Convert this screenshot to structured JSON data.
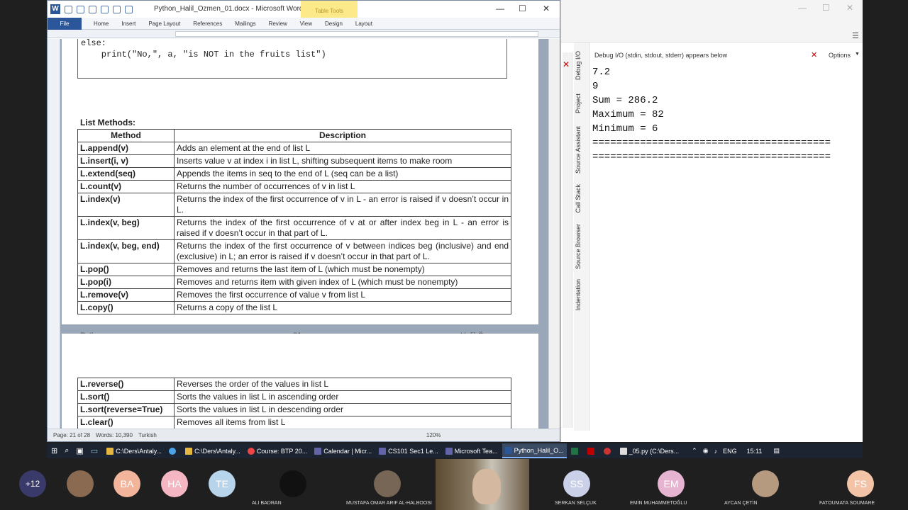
{
  "word": {
    "title": "Python_Halil_Ozmen_01.docx - Microsoft Word",
    "table_tools": "Table Tools",
    "tabs": [
      "File",
      "Home",
      "Insert",
      "Page Layout",
      "References",
      "Mailings",
      "Review",
      "View",
      "Design",
      "Layout"
    ],
    "code_lines": "else:\n    print(\"No,\", a, \"is NOT in the fruits list\")",
    "list_methods_title": "List Methods:",
    "table_headers": {
      "method": "Method",
      "description": "Description"
    },
    "rows": [
      {
        "m": "L.append(v)",
        "d": "Adds an element at the end of list L"
      },
      {
        "m": "L.insert(i, v)",
        "d": "Inserts value v at index i in list L, shifting subsequent items to make room"
      },
      {
        "m": "L.extend(seq)",
        "d": "Appends the items in seq to the end of L (seq can be a list)"
      },
      {
        "m": "L.count(v)",
        "d": "Returns the number of occurrences of v in list L"
      },
      {
        "m": "L.index(v)",
        "d": "Returns the index of the first occurrence of v in L - an error is raised if v doesn’t occur in L."
      },
      {
        "m": "L.index(v, beg)",
        "d": "Returns the index of the first occurrence of v at or after index beg in L - an error is raised if v doesn’t occur in that part of L."
      },
      {
        "m": "L.index(v, beg, end)",
        "d": "Returns the index of the first occurrence of v between indices beg (inclusive) and end (exclusive) in L; an error is raised if v doesn’t occur in that part of L."
      },
      {
        "m": "L.pop()",
        "d": "Removes and returns the last item of L (which must be nonempty)"
      },
      {
        "m": "L.pop(i)",
        "d": "Removes and returns item with given index of L (which must be nonempty)"
      },
      {
        "m": "L.remove(v)",
        "d": "Removes the first occurrence of value v from list L"
      },
      {
        "m": "L.copy()",
        "d": "Returns a copy of the list L"
      }
    ],
    "footer": {
      "left": "Python",
      "center": "21",
      "right": "Halil Özmen"
    },
    "rows2": [
      {
        "m": "L.reverse()",
        "d": "Reverses the order of the values in list L"
      },
      {
        "m": "L.sort()",
        "d": "Sorts the values in list L in ascending order"
      },
      {
        "m": "L.sort(reverse=True)",
        "d": "Sorts the values in list L in descending order"
      },
      {
        "m": "L.clear()",
        "d": "Removes all items from list L"
      }
    ],
    "status": {
      "page": "Page: 21 of 28",
      "words": "Words: 10,390",
      "lang": "Turkish",
      "zoom": "120%"
    }
  },
  "ide": {
    "header": "Debug I/O (stdin, stdout, stderr) appears below",
    "options": "Options",
    "vtabs": [
      "Debug I/O",
      "Project",
      "Source Assistant",
      "Call Stack",
      "Source Browser",
      "Indentation"
    ],
    "console": "7.2\n9\nSum = 286.2\nMaximum = 82\nMinimum = 6\n========================================\n========================================"
  },
  "taskbar": {
    "apps": [
      "C:\\Ders\\Antaly...",
      "",
      "C:\\Ders\\Antaly...",
      "Course: BTP 20...",
      "Calendar | Micr...",
      "CS101 Sec1 Le...",
      "Microsoft Tea...",
      "Python_Halil_O...",
      "",
      "",
      "",
      "_05.py (C:\\Ders..."
    ],
    "lang": "ENG",
    "time": "15:11"
  },
  "meeting": {
    "more": "+12",
    "people": [
      {
        "initials": "",
        "name": "",
        "color": "#8a6a50"
      },
      {
        "initials": "BA",
        "name": "",
        "color": "#f2b49a"
      },
      {
        "initials": "HA",
        "name": "",
        "color": "#f4b6c2"
      },
      {
        "initials": "TE",
        "name": "",
        "color": "#b8d4ea"
      },
      {
        "initials": "",
        "name": "ALI BADRAN",
        "color": "#111111"
      },
      {
        "initials": "",
        "name": "MUSTAFA OMAR ARIF AL-HALBOOSI",
        "color": "#776655"
      },
      {
        "initials": "SS",
        "name": "SERKAN SELÇUK",
        "color": "#c9d0e8"
      },
      {
        "initials": "EM",
        "name": "EMİN MUHAMMETOĞLU",
        "color": "#e6b4d0"
      },
      {
        "initials": "",
        "name": "AYCAN ÇETİN",
        "color": "#b59a80"
      },
      {
        "initials": "FS",
        "name": "FATOUMATA SOUMARE",
        "color": "#f2c3a6"
      }
    ]
  }
}
